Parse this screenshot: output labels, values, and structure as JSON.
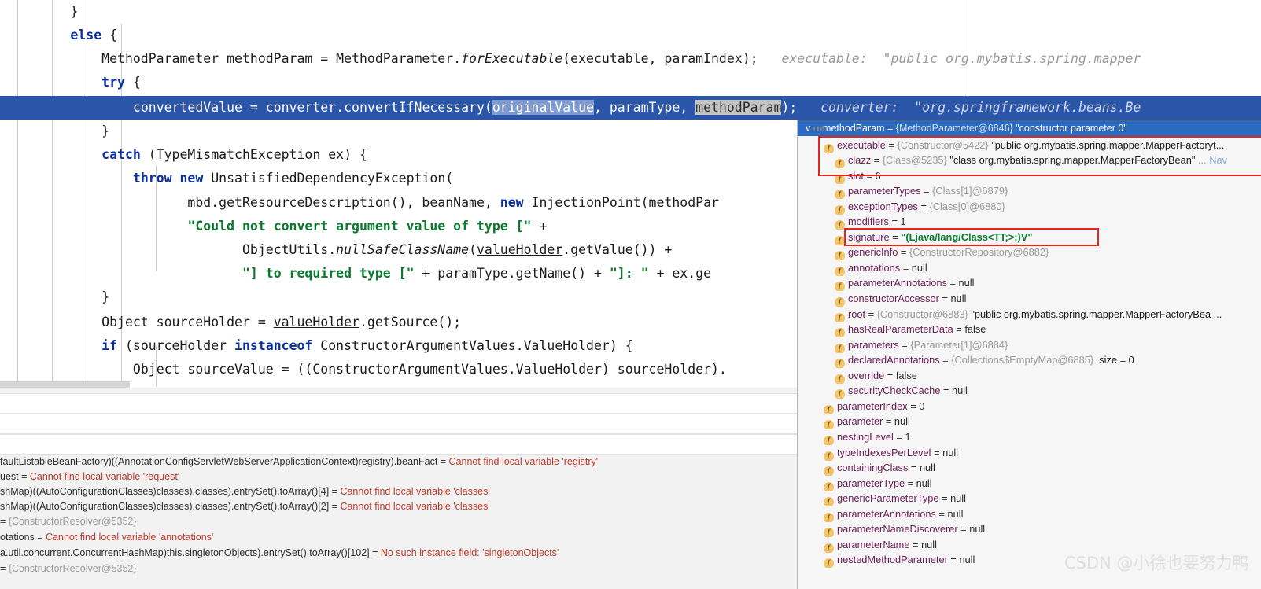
{
  "editor": {
    "lines": [
      {
        "indent": 9,
        "text": "}",
        "kind": "plain"
      },
      {
        "indent": 9,
        "text": "else {",
        "kind": "kw-else"
      },
      {
        "indent": 13,
        "text": "MethodParameter methodParam = MethodParameter.forExecutable(executable, paramIndex);",
        "kind": "methodparam-decl",
        "hint": "executable:  \"public org.mybatis.spring.mapper"
      },
      {
        "indent": 13,
        "text": "try {",
        "kind": "kw-try"
      },
      {
        "indent": 17,
        "text": "convertedValue = converter.convertIfNecessary(originalValue, paramType, methodParam);",
        "kind": "highlighted",
        "hint": "converter:  \"org.springframework.beans.Be"
      },
      {
        "indent": 13,
        "text": "}",
        "kind": "plain"
      },
      {
        "indent": 13,
        "text": "catch (TypeMismatchException ex) {",
        "kind": "kw-catch"
      },
      {
        "indent": 17,
        "text": "throw new UnsatisfiedDependencyException(",
        "kind": "throw-new"
      },
      {
        "indent": 24,
        "text": "mbd.getResourceDescription(), beanName, new InjectionPoint(methodPar",
        "kind": "mbd-line"
      },
      {
        "indent": 24,
        "text": "\"Could not convert argument value of type [\" +",
        "kind": "str-line"
      },
      {
        "indent": 31,
        "text": "ObjectUtils.nullSafeClassName(valueHolder.getValue()) +",
        "kind": "objutils-line"
      },
      {
        "indent": 31,
        "text": "\"] to required type [\" + paramType.getName() + \"]: \" + ex.ge",
        "kind": "str-line2"
      },
      {
        "indent": 13,
        "text": "}",
        "kind": "plain"
      },
      {
        "indent": 13,
        "text": "Object sourceHolder = valueHolder.getSource();",
        "kind": "sourceholder-line"
      },
      {
        "indent": 13,
        "text": "if (sourceHolder instanceof ConstructorArgumentValues.ValueHolder) {",
        "kind": "if-line"
      },
      {
        "indent": 17,
        "text": "Object sourceValue = ((ConstructorArgumentValues.ValueHolder) sourceHolder).",
        "kind": "sourcevalue-line"
      }
    ],
    "tokens": {
      "kw_else": "else",
      "kw_try": "try",
      "kw_catch": "catch",
      "kw_new": "new",
      "kw_throw": "throw",
      "kw_if": "if",
      "kw_instanceof": "instanceof",
      "sel_original_value": "originalValue",
      "sel_method_param": "methodParam"
    },
    "highlight_color": "#2a55a8",
    "keyword_color": "#0b2fa0",
    "string_color": "#0a7a2f",
    "hint_color": "#9a9a9a"
  },
  "variables_panel": {
    "rows": [
      {
        "text": "faultListableBeanFactory)((AnnotationConfigServletWebServerApplicationContext)registry).beanFact = ",
        "error": "Cannot find local variable 'registry'"
      },
      {
        "text": "uest = ",
        "error": "Cannot find local variable 'request'"
      },
      {
        "text": "shMap)((AutoConfigurationClasses)classes).classes).entrySet().toArray()[4] = ",
        "error": "Cannot find local variable 'classes'"
      },
      {
        "text": "shMap)((AutoConfigurationClasses)classes).classes).entrySet().toArray()[2] = ",
        "error": "Cannot find local variable 'classes'"
      },
      {
        "text": "= ",
        "ref": "{ConstructorResolver@5352}"
      },
      {
        "text": "otations = ",
        "error": "Cannot find local variable 'annotations'"
      },
      {
        "text": "a.util.concurrent.ConcurrentHashMap)this.singletonObjects).entrySet().toArray()[102] = ",
        "error": "No such instance field: 'singletonObjects'"
      },
      {
        "text": "= ",
        "ref": "{ConstructorResolver@5352}"
      }
    ]
  },
  "popup": {
    "header": {
      "chevron": "v",
      "icon": "oo",
      "name": "methodParam",
      "eq": " = ",
      "ref": "{MethodParameter@6846}",
      "value": " \"constructor parameter 0\""
    },
    "tree": [
      {
        "depth": 1,
        "expandable": true,
        "expanded": true,
        "name": "executable",
        "eq": " = ",
        "ref": "{Constructor@5422}",
        "value": " \"public org.mybatis.spring.mapper.MapperFactoryt...",
        "style": "plain"
      },
      {
        "depth": 2,
        "expandable": true,
        "expanded": false,
        "name": "clazz",
        "eq": " = ",
        "ref": "{Class@5235}",
        "value": " \"class org.mybatis.spring.mapper.MapperFactoryBean\"",
        "ellipsis": " ...",
        "nav": " Nav",
        "style": "plain"
      },
      {
        "depth": 2,
        "expandable": false,
        "name": "slot",
        "eq": " = ",
        "value": "6",
        "style": "num"
      },
      {
        "depth": 2,
        "expandable": true,
        "expanded": false,
        "name": "parameterTypes",
        "eq": " = ",
        "ref": "{Class[1]@6879}",
        "style": "plain"
      },
      {
        "depth": 2,
        "expandable": false,
        "name": "exceptionTypes",
        "eq": " = ",
        "ref": "{Class[0]@6880}",
        "style": "plain"
      },
      {
        "depth": 2,
        "expandable": false,
        "name": "modifiers",
        "eq": " = ",
        "value": "1",
        "style": "num"
      },
      {
        "depth": 2,
        "expandable": true,
        "expanded": false,
        "name": "signature",
        "eq": " = ",
        "value": "\"(Ljava/lang/Class<TT;>;)V\"",
        "style": "green"
      },
      {
        "depth": 2,
        "expandable": true,
        "expanded": false,
        "name": "genericInfo",
        "eq": " = ",
        "ref": "{ConstructorRepository@6882}",
        "style": "plain"
      },
      {
        "depth": 2,
        "expandable": false,
        "name": "annotations",
        "eq": " = ",
        "value": "null",
        "style": "num"
      },
      {
        "depth": 2,
        "expandable": false,
        "name": "parameterAnnotations",
        "eq": " = ",
        "value": "null",
        "style": "num"
      },
      {
        "depth": 2,
        "expandable": false,
        "name": "constructorAccessor",
        "eq": " = ",
        "value": "null",
        "style": "num"
      },
      {
        "depth": 2,
        "expandable": true,
        "expanded": false,
        "name": "root",
        "eq": " = ",
        "ref": "{Constructor@6883}",
        "value": " \"public org.mybatis.spring.mapper.MapperFactoryBea ...",
        "style": "plain"
      },
      {
        "depth": 2,
        "expandable": false,
        "name": "hasRealParameterData",
        "eq": " = ",
        "value": "false",
        "style": "num"
      },
      {
        "depth": 2,
        "expandable": true,
        "expanded": false,
        "name": "parameters",
        "eq": " = ",
        "ref": "{Parameter[1]@6884}",
        "style": "plain"
      },
      {
        "depth": 2,
        "expandable": false,
        "name": "declaredAnnotations",
        "eq": " = ",
        "ref": "{Collections$EmptyMap@6885}",
        "value": "  size = 0",
        "style": "plain"
      },
      {
        "depth": 2,
        "expandable": false,
        "name": "override",
        "eq": " = ",
        "value": "false",
        "style": "num"
      },
      {
        "depth": 2,
        "expandable": false,
        "name": "securityCheckCache",
        "eq": " = ",
        "value": "null",
        "style": "num"
      },
      {
        "depth": 1,
        "expandable": false,
        "name": "parameterIndex",
        "eq": " = ",
        "value": "0",
        "style": "num"
      },
      {
        "depth": 1,
        "expandable": false,
        "name": "parameter",
        "eq": " = ",
        "value": "null",
        "style": "num"
      },
      {
        "depth": 1,
        "expandable": false,
        "name": "nestingLevel",
        "eq": " = ",
        "value": "1",
        "style": "num"
      },
      {
        "depth": 1,
        "expandable": false,
        "name": "typeIndexesPerLevel",
        "eq": " = ",
        "value": "null",
        "style": "num"
      },
      {
        "depth": 1,
        "expandable": false,
        "name": "containingClass",
        "eq": " = ",
        "value": "null",
        "style": "num"
      },
      {
        "depth": 1,
        "expandable": false,
        "name": "parameterType",
        "eq": " = ",
        "value": "null",
        "style": "num"
      },
      {
        "depth": 1,
        "expandable": false,
        "name": "genericParameterType",
        "eq": " = ",
        "value": "null",
        "style": "num"
      },
      {
        "depth": 1,
        "expandable": false,
        "name": "parameterAnnotations",
        "eq": " = ",
        "value": "null",
        "style": "num"
      },
      {
        "depth": 1,
        "expandable": false,
        "name": "parameterNameDiscoverer",
        "eq": " = ",
        "value": "null",
        "style": "num"
      },
      {
        "depth": 1,
        "expandable": false,
        "name": "parameterName",
        "eq": " = ",
        "value": "null",
        "style": "num"
      },
      {
        "depth": 1,
        "expandable": false,
        "name": "nestedMethodParameter",
        "eq": " = ",
        "value": "null",
        "style": "num"
      }
    ]
  },
  "annotations": {
    "red_box_1": {
      "label": "executable-clazz-slot-highlight"
    },
    "red_box_2": {
      "label": "signature-highlight"
    },
    "color": "#e8231a"
  },
  "watermark": {
    "text": "CSDN @小徐也要努力鸭"
  }
}
